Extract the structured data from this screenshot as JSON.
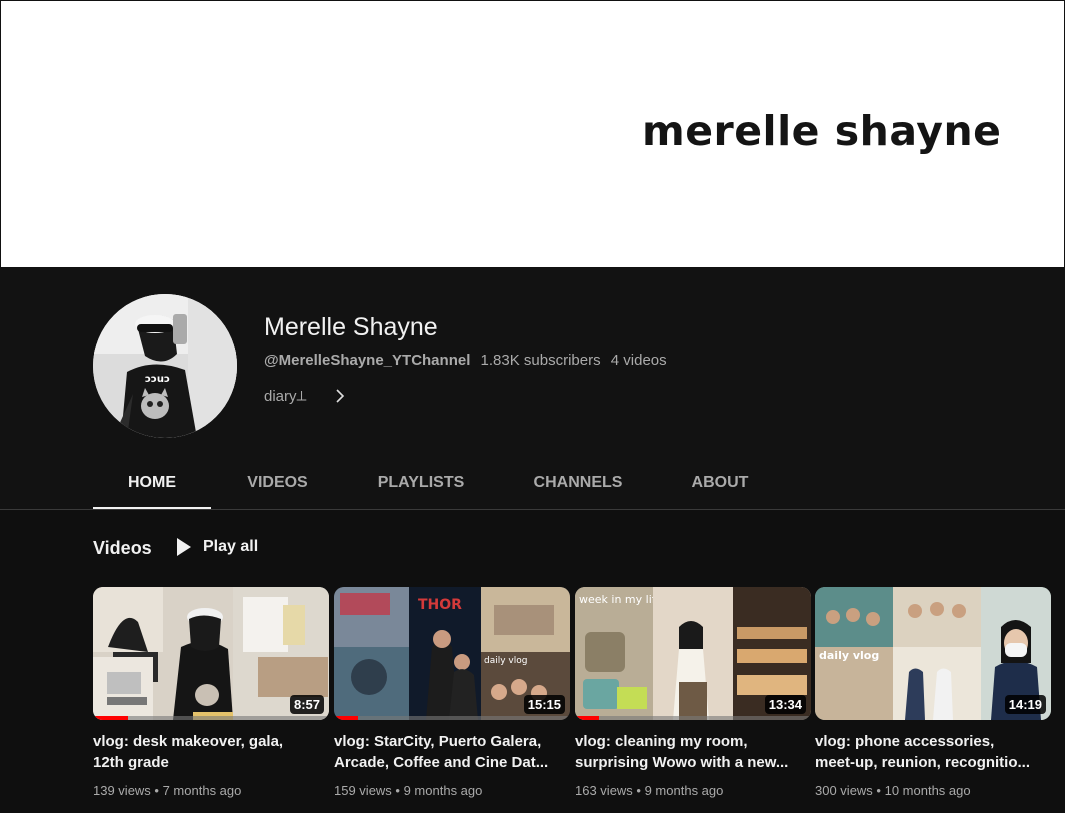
{
  "banner": {
    "text": "merelle shayne"
  },
  "channel": {
    "name": "Merelle Shayne",
    "handle": "@MerelleShayne_YTChannel",
    "subscribers": "1.83K subscribers",
    "video_count": "4 videos",
    "description": "diary🜃",
    "description_display": "diary⟂"
  },
  "tabs": [
    {
      "label": "HOME",
      "active": true
    },
    {
      "label": "VIDEOS",
      "active": false
    },
    {
      "label": "PLAYLISTS",
      "active": false
    },
    {
      "label": "CHANNELS",
      "active": false
    },
    {
      "label": "ABOUT",
      "active": false
    }
  ],
  "section": {
    "title": "Videos",
    "play_all": "Play all"
  },
  "videos": [
    {
      "title": "vlog: desk makeover, gala,\n12th grade",
      "duration": "8:57",
      "views": "139 views",
      "age": "7 months ago",
      "watched_fraction": 0.15
    },
    {
      "title": "vlog: StarCity, Puerto Galera,\nArcade, Coffee and Cine Dat...",
      "duration": "15:15",
      "views": "159 views",
      "age": "9 months ago",
      "watched_fraction": 0.1
    },
    {
      "title": "vlog: cleaning my room,\nsurprising Wowo with a new...",
      "duration": "13:34",
      "views": "163 views",
      "age": "9 months ago",
      "watched_fraction": 0.1
    },
    {
      "title": "vlog: phone accessories,\nmeet-up, reunion, recognitio...",
      "duration": "14:19",
      "views": "300 views",
      "age": "10 months ago",
      "watched_fraction": 0
    }
  ],
  "colors": {
    "accent": "#ff0000",
    "background": "#0f0f0f",
    "header_bg": "#121212",
    "text_secondary": "#aaaaaa"
  }
}
